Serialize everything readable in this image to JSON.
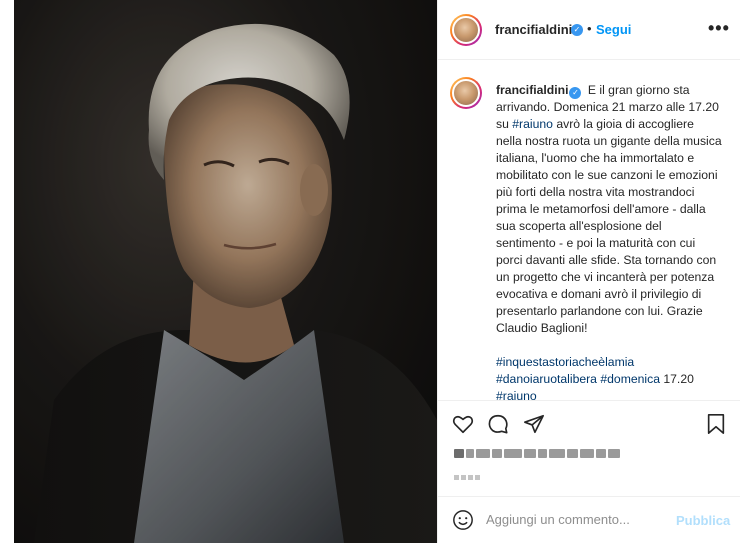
{
  "post": {
    "username": "francifialdini",
    "verified_icon": "verified-badge-icon",
    "separator": "•",
    "follow_label": "Segui",
    "more_label": "•••"
  },
  "caption": {
    "username": "francifialdini",
    "part1": "E il gran giorno sta arrivando. Domenica 21 marzo alle 17.20 su ",
    "tag_raiuno": "#raiuno",
    "part2": " avrò la gioia di accogliere nella nostra ruota un gigante della musica italiana, l'uomo che ha immortalato e mobilitato con le sue canzoni le emozioni più forti della nostra vita mostrandoci prima le metamorfosi dell'amore - dalla sua scoperta all'esplosione del sentimento - e poi la maturità con cui porci davanti alle sfide. Sta tornando con un progetto che vi incanterà per potenza evocativa e domani avrò il privilegio di presentarlo parlandone con lui. Grazie Claudio Baglioni!",
    "tag1": "#inquestastoriacheèlamia",
    "tag2": "#danoiaruotalibera",
    "tag3": "#domenica",
    "time_text": " 17.20",
    "tag4": "#raiuno"
  },
  "actions": {
    "like_icon": "heart-icon",
    "comment_icon": "comment-icon",
    "share_icon": "send-icon",
    "save_icon": "bookmark-icon"
  },
  "comment": {
    "emoji_icon": "emoji-icon",
    "placeholder": "Aggiungi un commento...",
    "publish_label": "Pubblica"
  },
  "colors": {
    "link": "#0095f6",
    "hashtag": "#00376b",
    "publish_disabled": "#b2dffc",
    "verified": "#3897f0"
  }
}
